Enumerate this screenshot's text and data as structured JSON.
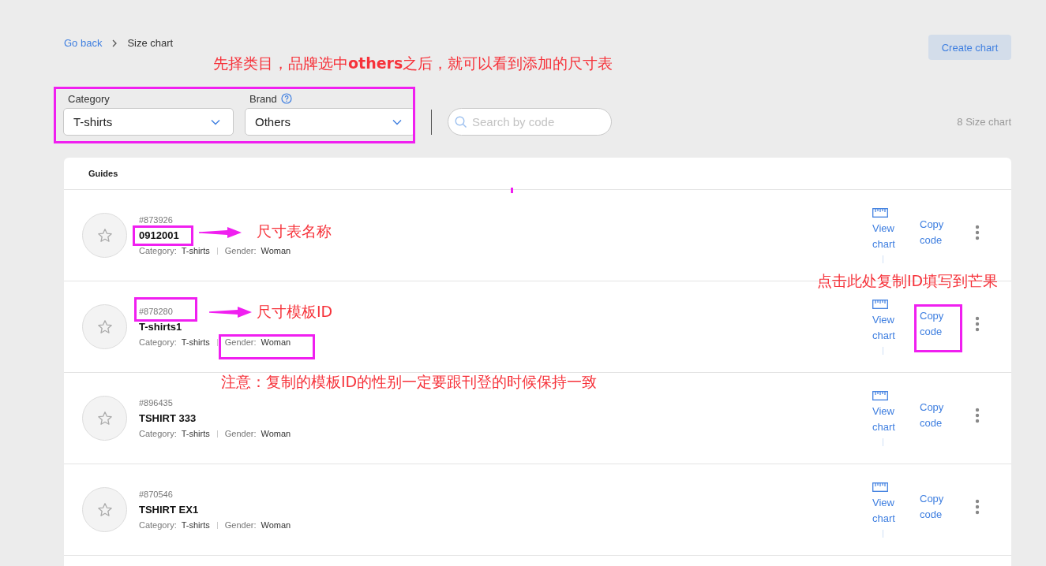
{
  "breadcrumb": {
    "back": "Go back",
    "current": "Size chart"
  },
  "create_button": "Create chart",
  "filters": [
    {
      "label": "Category",
      "value": "T-shirts",
      "help": false
    },
    {
      "label": "Brand",
      "value": "Others",
      "help": true
    }
  ],
  "search": {
    "placeholder": "Search by code"
  },
  "count": "8 Size chart",
  "list_header": "Guides",
  "rows": [
    {
      "id": "#873926",
      "name": "0912001",
      "category_label": "Category:",
      "category": "T-shirts",
      "gender_label": "Gender:",
      "gender": "Woman",
      "view": "View chart",
      "copy": "Copy code"
    },
    {
      "id": "#878280",
      "name": "T-shirts1",
      "category_label": "Category:",
      "category": "T-shirts",
      "gender_label": "Gender:",
      "gender": "Woman",
      "view": "View chart",
      "copy": "Copy code"
    },
    {
      "id": "#896435",
      "name": "TSHIRT 333",
      "category_label": "Category:",
      "category": "T-shirts",
      "gender_label": "Gender:",
      "gender": "Woman",
      "view": "View chart",
      "copy": "Copy code"
    },
    {
      "id": "#870546",
      "name": "TSHIRT EX1",
      "category_label": "Category:",
      "category": "T-shirts",
      "gender_label": "Gender:",
      "gender": "Woman",
      "view": "View chart",
      "copy": "Copy code"
    }
  ],
  "annotations": [
    "先择类目，品牌选中**others**之后，就可以看到添加的尺寸表",
    "尺寸表名称",
    "点击此处复制ID填写到芒果",
    "尺寸模板ID",
    "注意：复制的模板ID的性别一定要跟刊登的时候保持一致"
  ]
}
